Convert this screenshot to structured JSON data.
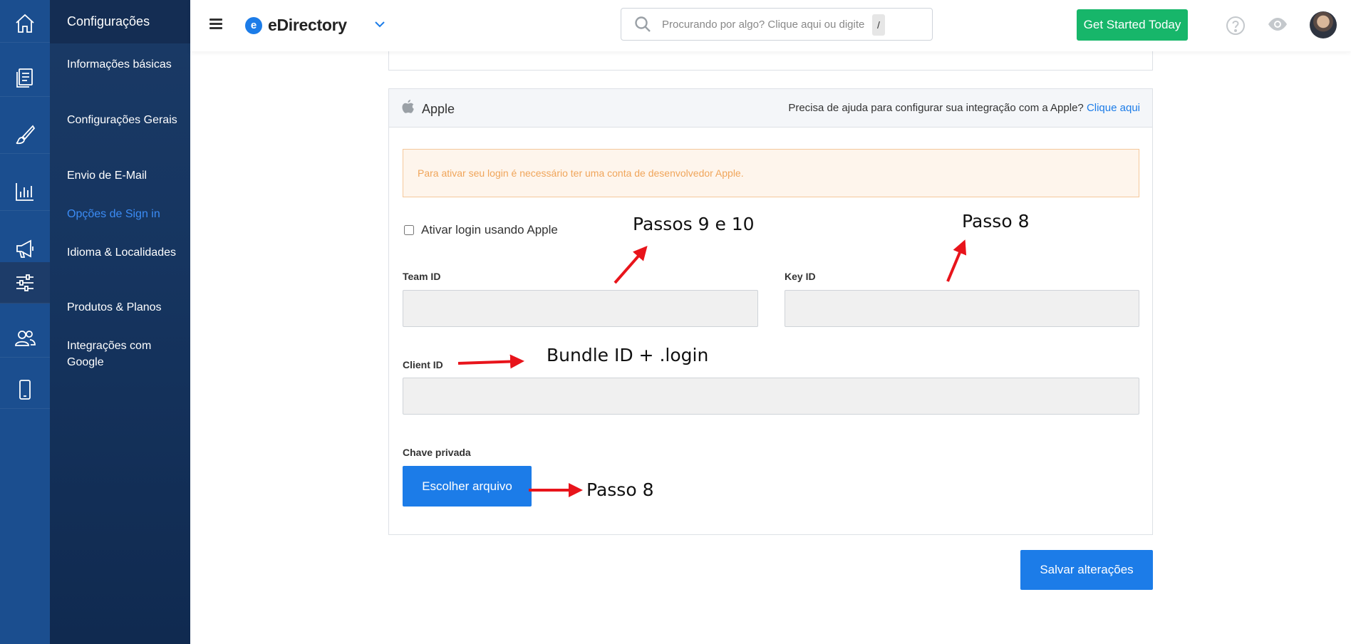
{
  "rail": {
    "items": [
      {
        "icon": "home-icon"
      },
      {
        "icon": "document-icon"
      },
      {
        "icon": "brush-icon"
      },
      {
        "icon": "chart-icon"
      },
      {
        "icon": "megaphone-icon"
      },
      {
        "icon": "sliders-icon",
        "active": true
      },
      {
        "icon": "users-icon"
      },
      {
        "icon": "mobile-icon"
      }
    ]
  },
  "sidebar": {
    "title": "Configurações",
    "items": [
      {
        "label": "Informações básicas"
      },
      {
        "label": "Configurações Gerais"
      },
      {
        "label": "Envio de E-Mail"
      },
      {
        "label": "Opções de Sign in",
        "active": true
      },
      {
        "label": "Idioma & Localidades"
      },
      {
        "label": "Produtos & Planos"
      },
      {
        "label": "Integrações com Google"
      }
    ]
  },
  "topbar": {
    "brand_letter": "e",
    "brand_name": "eDirectory",
    "search_placeholder": "Procurando por algo? Clique aqui ou digite",
    "search_shortcut": "/",
    "cta_label": "Get Started Today"
  },
  "apple_panel": {
    "title": "Apple",
    "help_text": "Precisa de ajuda para configurar sua integração com a Apple?",
    "help_link": "Clique aqui",
    "alert": "Para ativar seu login é necessário ter uma conta de desenvolvedor Apple.",
    "checkbox_label": "Ativar login usando Apple",
    "team_id_label": "Team ID",
    "team_id_value": "",
    "key_id_label": "Key ID",
    "key_id_value": "",
    "client_id_label": "Client ID",
    "client_id_value": "",
    "private_key_label": "Chave privada",
    "file_button": "Escolher arquivo"
  },
  "save_button": "Salvar alterações",
  "annotations": {
    "team_id": "Passos 9 e 10",
    "key_id": "Passo 8",
    "client_id": "Bundle ID + .login",
    "private_key": "Passo 8"
  },
  "colors": {
    "rail_bg": "#1b4e8f",
    "sidebar_active": "#3b8cf5",
    "primary": "#1c7ce8",
    "cta": "#17b66a",
    "alert_text": "#f0a55a",
    "annotation_arrow": "#e8141b"
  }
}
